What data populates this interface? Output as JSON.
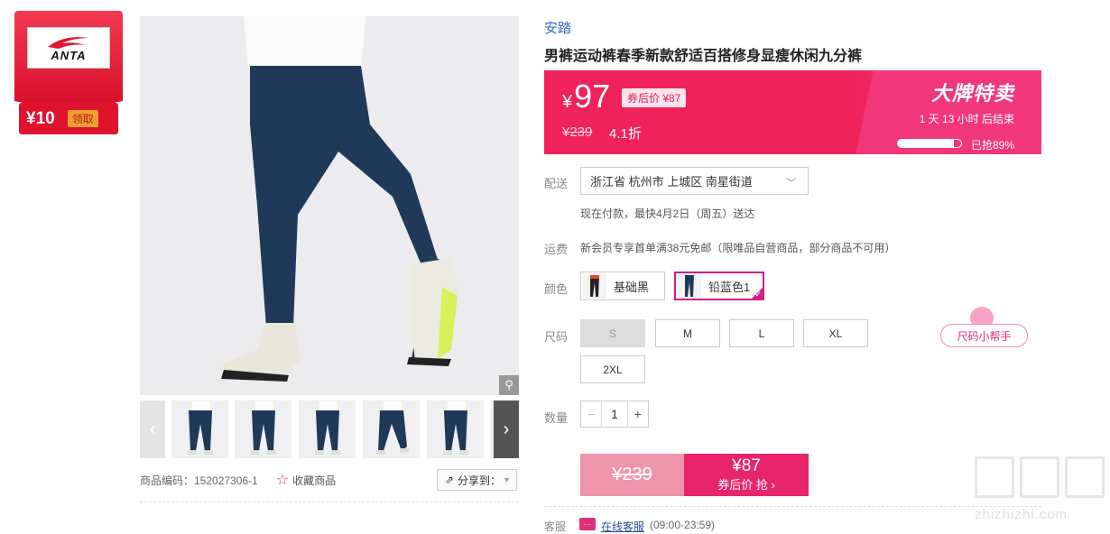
{
  "coupon": {
    "amount": "¥10",
    "claim_label": "领取",
    "brand_text": "ANTA"
  },
  "product": {
    "brand": "安踏",
    "title": "男裤运动裤春季新款舒适百搭修身显瘦休闲九分裤",
    "code": "商品编码：152027306-1",
    "favorite_label": "收藏商品",
    "share_label": "分享到："
  },
  "price": {
    "currency": "¥",
    "current": "97",
    "after_coupon": "券后价 ¥87",
    "original": "¥239",
    "discount": "4.1折",
    "sale_title": "大牌特卖",
    "countdown": "1 天 13 小时 后结束",
    "sold_label": "已抢89%",
    "sold_fraction": 0.89
  },
  "shipping": {
    "label": "配送",
    "address": "浙江省 杭州市 上城区 南星街道",
    "delivery_note": "现在付款，最快4月2日（周五）送达",
    "freight_label": "运费",
    "freight_note": "新会员专享首单满38元免邮（限唯品自营商品，部分商品不可用）"
  },
  "color": {
    "label": "颜色",
    "options": [
      {
        "name": "基础黑",
        "selected": false
      },
      {
        "name": "铅蓝色1",
        "selected": true
      }
    ]
  },
  "size": {
    "label": "尺码",
    "options": [
      {
        "name": "S",
        "disabled": true
      },
      {
        "name": "M",
        "disabled": false
      },
      {
        "name": "L",
        "disabled": false
      },
      {
        "name": "XL",
        "disabled": false
      },
      {
        "name": "2XL",
        "disabled": false
      }
    ],
    "helper_label": "尺码小帮手"
  },
  "quantity": {
    "label": "数量",
    "value": "1",
    "minus": "−",
    "plus": "+"
  },
  "buy": {
    "original_price": "¥239",
    "coupon_price": "¥87",
    "coupon_label": "券后价 抢 ›"
  },
  "service": {
    "label": "客服",
    "link_text": "在线客服",
    "hours": "(09:00-23:59)"
  },
  "watermark": {
    "text": "zhizhizhi.com"
  },
  "icons": {
    "zoom": "magnifier-icon",
    "star": "star-icon",
    "share": "share-icon",
    "chat": "chat-icon"
  },
  "colors": {
    "accent": "#f0225a",
    "brand_link": "#2a6fc9",
    "selected_border": "#d41e8a"
  }
}
